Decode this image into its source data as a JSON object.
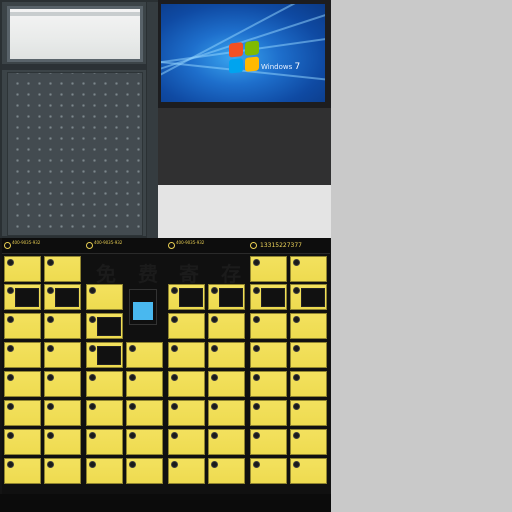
{
  "scene": {
    "background": "#c8c8c8",
    "cabinet": {
      "body_color": "#3c4448",
      "window_color": "#ecedeb"
    },
    "monitor": {
      "bezel_color": "#1d1d1f",
      "wallpaper_color": "#1e6fcc",
      "os_brand": "Windows",
      "os_version": "7"
    },
    "lockers": {
      "door_color": "#eedb50",
      "frame_color": "#141414",
      "headers": [
        {
          "phone": "400-9035-932"
        },
        {
          "phone": "400-9035-932"
        },
        {
          "phone": "400-9035-932"
        },
        {
          "hotline": "13315227377"
        }
      ],
      "banner_chars": [
        "免",
        "费",
        "寄",
        "存"
      ]
    }
  }
}
